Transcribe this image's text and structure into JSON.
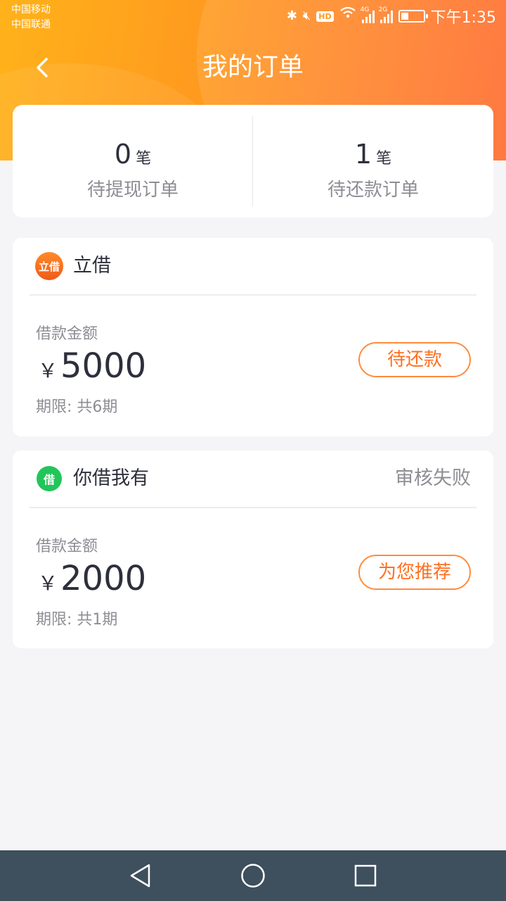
{
  "status_bar": {
    "carrier1": "中国移动",
    "carrier2": "中国联通",
    "hd": "HD",
    "net1": "4G",
    "net2": "2G",
    "time": "下午1:35",
    "battery_level": 0.35
  },
  "nav": {
    "title": "我的订单"
  },
  "summary": [
    {
      "count": "0",
      "unit": "笔",
      "label": "待提现订单"
    },
    {
      "count": "1",
      "unit": "笔",
      "label": "待还款订单"
    }
  ],
  "orders": [
    {
      "logo_text": "立借",
      "name": "立借",
      "head_status": "",
      "amount_label": "借款金额",
      "currency": "￥",
      "amount": "5000",
      "term": "期限: 共6期",
      "button": "待还款"
    },
    {
      "logo_text": "借",
      "name": "你借我有",
      "head_status": "审核失败",
      "amount_label": "借款金额",
      "currency": "￥",
      "amount": "2000",
      "term": "期限: 共1期",
      "button": "为您推荐"
    }
  ],
  "colors": {
    "accent": "#ff7f2a",
    "button_text": "#ff6f1f",
    "system_nav": "#3e4f5d"
  }
}
